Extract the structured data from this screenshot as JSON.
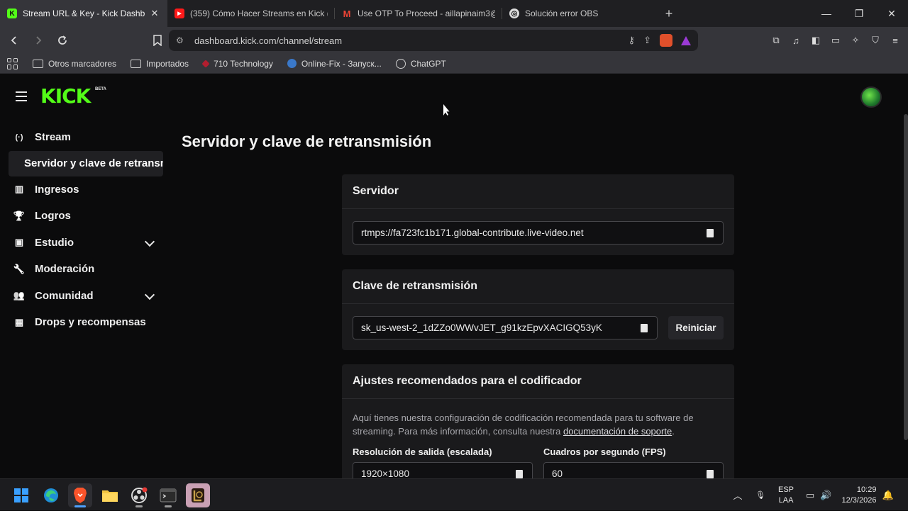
{
  "browser": {
    "tabs": [
      {
        "title": "Stream URL & Key - Kick Dashbo",
        "favicon": "K",
        "color": "#53fc18",
        "active": true
      },
      {
        "title": "(359) Cómo Hacer Streams en Kick (C",
        "favicon": "▶",
        "color": "#ff1a1a",
        "active": false
      },
      {
        "title": "Use OTP To Proceed - aillapinaim3@",
        "favicon": "M",
        "color": "#ea4335",
        "active": false
      },
      {
        "title": "Solución error OBS",
        "favicon": "◎",
        "color": "#dcdcdc",
        "active": false
      }
    ],
    "new_tab": "+",
    "window_controls": {
      "minimize": "—",
      "maximize": "❐",
      "close": "✕"
    },
    "url": "dashboard.kick.com/channel/stream",
    "bookmarks": [
      "Otros marcadores",
      "Importados",
      "710 Technology",
      "Online-Fix - Запуск...",
      "ChatGPT"
    ]
  },
  "kick": {
    "logo": "KICK",
    "logo_badge": "BETA",
    "sidebar": [
      {
        "label": "Stream",
        "icon": "broadcast-icon",
        "glyph": "(·)"
      },
      {
        "label": "Servidor y clave de retransmisión",
        "sub": true
      },
      {
        "label": "Ingresos",
        "icon": "chart-icon",
        "glyph": "▥"
      },
      {
        "label": "Logros",
        "icon": "trophy-icon",
        "glyph": "🏆"
      },
      {
        "label": "Estudio",
        "icon": "studio-icon",
        "glyph": "▣",
        "expandable": true
      },
      {
        "label": "Moderación",
        "icon": "wrench-icon",
        "glyph": "🔧"
      },
      {
        "label": "Comunidad",
        "icon": "community-icon",
        "glyph": "👥",
        "expandable": true
      },
      {
        "label": "Drops y recompensas",
        "icon": "drops-icon",
        "glyph": "▦"
      }
    ],
    "page_title": "Servidor y clave de retransmisión",
    "server": {
      "title": "Servidor",
      "value": "rtmps://fa723fc1b171.global-contribute.live-video.net"
    },
    "stream_key": {
      "title": "Clave de retransmisión",
      "value": "sk_us-west-2_1dZZo0WWvJET_g91kzEpvXACIGQ53yK",
      "reset": "Reiniciar"
    },
    "encoder": {
      "title": "Ajustes recomendados para el codificador",
      "desc_before": "Aquí tienes nuestra configuración de codificación recomendada para tu software de streaming. Para más información, consulta nuestra ",
      "desc_link": "documentación de soporte",
      "desc_after": ".",
      "resolution_label": "Resolución de salida (escalada)",
      "resolution_value": "1920×1080",
      "fps_label": "Cuadros por segundo (FPS)",
      "fps_value": "60"
    }
  },
  "taskbar": {
    "apps": [
      "windows-start",
      "edge",
      "brave",
      "file-explorer",
      "obs",
      "terminal",
      "league"
    ],
    "lang": "ESP",
    "layout": "LAA",
    "time": "10:29",
    "date": "12/3/2026"
  }
}
